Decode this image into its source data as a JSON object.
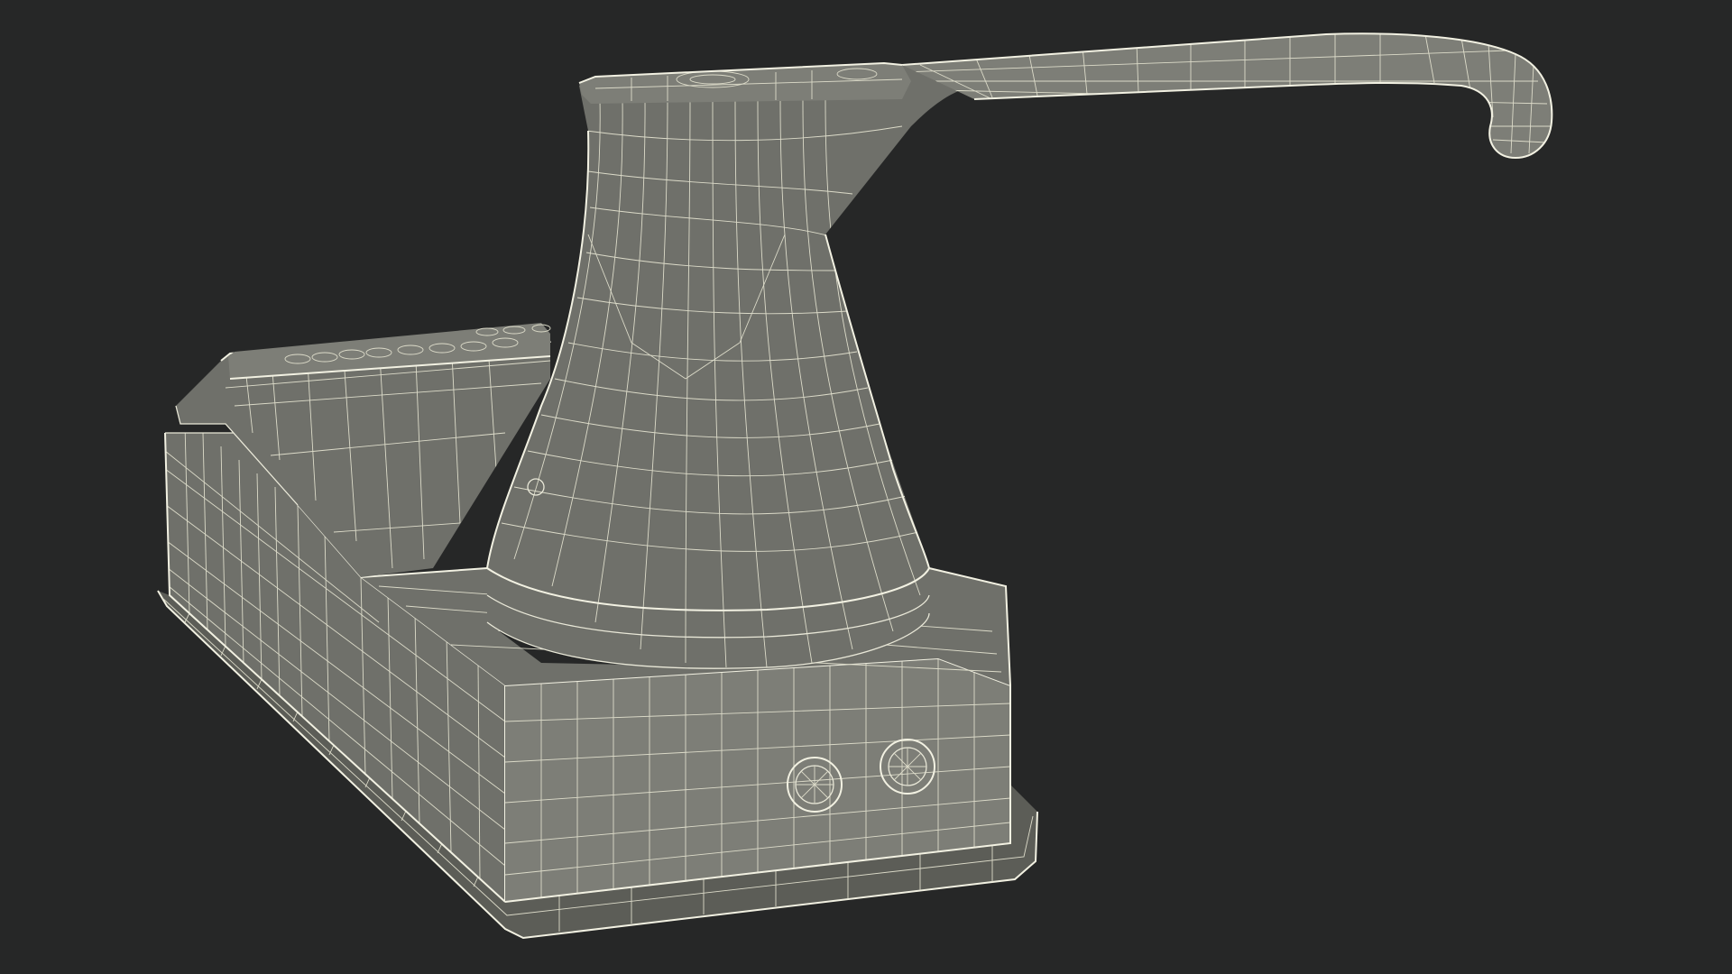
{
  "scene": {
    "background_color": "#262727",
    "mesh_color": "#6f706a",
    "wire_color": "#e9e8d8",
    "subject": "wireframe-render"
  }
}
